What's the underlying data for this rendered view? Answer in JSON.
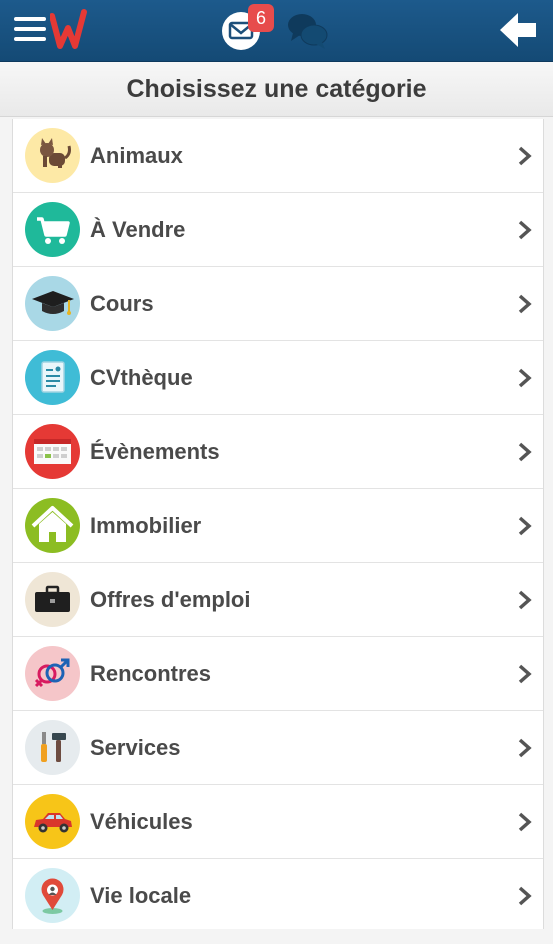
{
  "header": {
    "mail_badge": "6",
    "icons": [
      "menu-icon",
      "app-logo",
      "mail-icon",
      "chat-icon",
      "back-arrow-icon"
    ]
  },
  "page": {
    "title": "Choisissez une catégorie"
  },
  "categories": [
    {
      "label": "Animaux",
      "icon": "cat-icon",
      "color": "#fde9a6"
    },
    {
      "label": "À Vendre",
      "icon": "shopping-cart-icon",
      "color": "#1fb99a"
    },
    {
      "label": "Cours",
      "icon": "graduation-cap-icon",
      "color": "#a9d8e6"
    },
    {
      "label": "CVthèque",
      "icon": "resume-document-icon",
      "color": "#3fbcd6"
    },
    {
      "label": "Évènements",
      "icon": "calendar-icon",
      "color": "#e53935"
    },
    {
      "label": "Immobilier",
      "icon": "house-icon",
      "color": "#8cbd22"
    },
    {
      "label": "Offres d'emploi",
      "icon": "briefcase-icon",
      "color": "#efe6d6"
    },
    {
      "label": "Rencontres",
      "icon": "gender-symbols-icon",
      "color": "#f5c6c9"
    },
    {
      "label": "Services",
      "icon": "tools-icon",
      "color": "#e6ebee"
    },
    {
      "label": "Véhicules",
      "icon": "car-icon",
      "color": "#f7c518"
    },
    {
      "label": "Vie locale",
      "icon": "map-pin-icon",
      "color": "#d2eef4"
    }
  ]
}
